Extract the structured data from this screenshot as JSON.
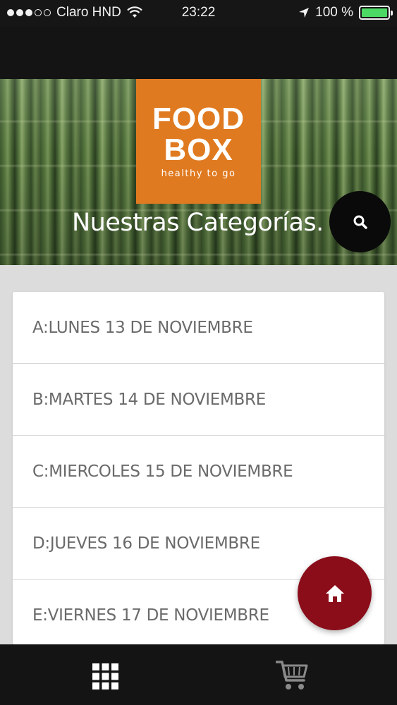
{
  "status_bar": {
    "carrier": "Claro HND",
    "time": "23:22",
    "battery": "100 %",
    "battery_color": "#4cd964"
  },
  "hero": {
    "logo_line1": "FOOD",
    "logo_line2": "BOX",
    "logo_tagline": "healthy to go",
    "logo_color": "#e07a20",
    "title": "Nuestras Categorías."
  },
  "categories": [
    "A:LUNES 13 DE NOVIEMBRE",
    "B:MARTES 14 DE NOVIEMBRE",
    "C:MIERCOLES 15 DE NOVIEMBRE",
    "D:JUEVES 16 DE NOVIEMBRE",
    "E:VIERNES 17 DE NOVIEMBRE"
  ],
  "icons": {
    "search": "search-icon",
    "home": "home-icon",
    "grid": "grid-icon",
    "cart": "cart-icon"
  },
  "colors": {
    "home_fab": "#8b0d1a",
    "search_fab": "#0a0a0a"
  }
}
